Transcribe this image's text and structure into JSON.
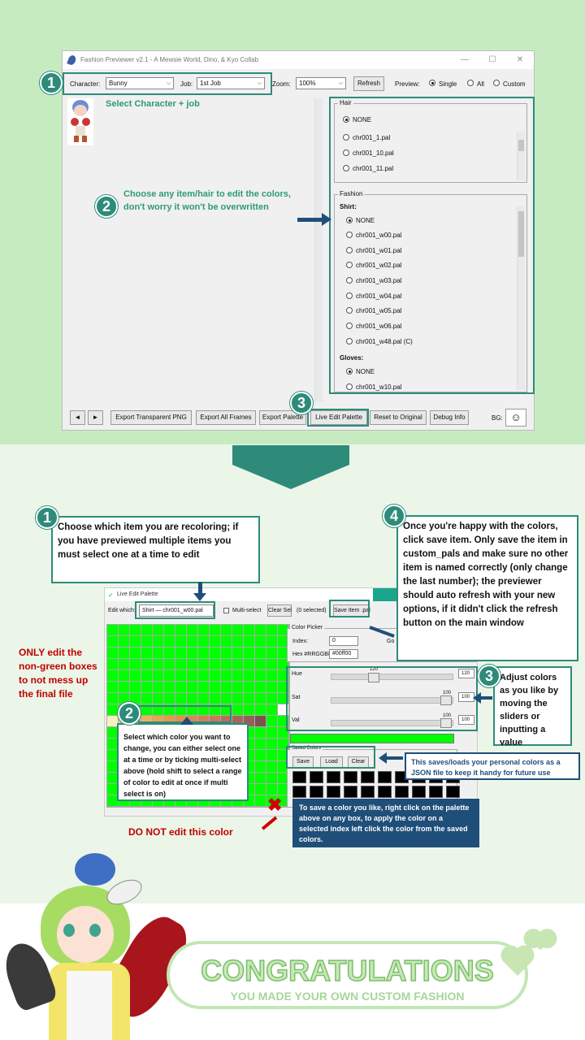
{
  "app": {
    "title": "Fashion Previewer v2.1 - A Mewsie World, Dino, & Kyo Collab",
    "minimize": "—",
    "maximize": "☐",
    "close": "✕"
  },
  "toolbar": {
    "character_label": "Character:",
    "character_value": "Bunny",
    "job_label": "Job:",
    "job_value": "1st Job",
    "zoom_label": "Zoom:",
    "zoom_value": "100%",
    "refresh": "Refresh",
    "preview_label": "Preview:",
    "preview_options": [
      "Single",
      "All",
      "Custom"
    ]
  },
  "hair": {
    "title": "Hair",
    "items": [
      "NONE",
      "chr001_1.pal",
      "chr001_10.pal",
      "chr001_11.pal"
    ]
  },
  "fashion": {
    "title": "Fashion",
    "shirt_label": "Shirt:",
    "shirt_items": [
      "NONE",
      "chr001_w00.pal",
      "chr001_w01.pal",
      "chr001_w02.pal",
      "chr001_w03.pal",
      "chr001_w04.pal",
      "chr001_w05.pal",
      "chr001_w06.pal",
      "chr001_w48.pal (C)"
    ],
    "gloves_label": "Gloves:",
    "gloves_items": [
      "NONE",
      "chr001_w10.pal"
    ]
  },
  "bottom_bar": {
    "prev": "◄",
    "next": "►",
    "export_png": "Export Transparent PNG",
    "export_frames": "Export All Frames",
    "export_palette": "Export Palette",
    "live_edit": "Live Edit Palette",
    "reset": "Reset to Original",
    "debug": "Debug Info",
    "bg_label": "BG:"
  },
  "callouts_top": {
    "n1": "1",
    "n2": "2",
    "n3": "3",
    "select_char": "Select Character + job",
    "choose_item": "Choose any item/hair to edit the colors, don't worry it won't be overwritten"
  },
  "live_edit": {
    "title": "Live Edit Palette",
    "edit_which_label": "Edit which:",
    "edit_which_value": "Shirt — chr001_w00.pal",
    "multi_select": "Multi-select",
    "clear_sel": "Clear Sel",
    "selected": "(0 selected)",
    "save_item": "Save Item .pal",
    "color_picker": "Color Picker",
    "index_label": "Index:",
    "index_value": "0",
    "go": "Go",
    "hex_label": "Hex #RRGGBB:",
    "hex_value": "#00ff00",
    "hue_label": "Hue",
    "hue_value": "120",
    "sat_label": "Sat",
    "sat_value": "100",
    "val_label": "Val",
    "val_value": "100",
    "saved_colors": "Saved Colors",
    "save": "Save",
    "load": "Load",
    "clear": "Clear"
  },
  "palette_colors": [
    "#f6d27e",
    "#f3c070",
    "#eeb060",
    "#e8a453",
    "#e39a4c",
    "#dd9050",
    "#d88758",
    "#d07e5a",
    "#c9785a",
    "#b86f58",
    "#a6665a",
    "#965e5a",
    "#7d524e"
  ],
  "callouts_bottom": {
    "n1": "1",
    "n2": "2",
    "n3": "3",
    "n4": "4",
    "choose_which": "Choose which item you are recoloring; if you have previewed multiple items you must select one at a time to edit",
    "save_note": "Once you're happy with the colors, click save item. Only save the item in custom_pals and make sure no other item is named correctly (only change the last number); the previewer should auto refresh with your new options, if it didn't click the refresh button on the main window",
    "only_edit": "ONLY edit the non-green boxes to not mess up the final file",
    "select_color": "Select which color you want to change, you can either select one at a time or by ticking multi-select above (hold shift to select a range of color to edit at once if multi select is on)",
    "adjust": "Adjust colors as you like by moving the sliders or inputting a value",
    "saves_loads": "This saves/loads your personal colors as a JSON file to keep it handy for future use",
    "right_click": "To save a color you like, right click on the palette above on any box, to apply the color on a selected index left click the color from the saved colors.",
    "do_not": "DO NOT edit this color"
  },
  "footer": {
    "congrats": "CONGRATULATIONS",
    "subtitle": "YOU MADE YOUR OWN CUSTOM FASHION"
  },
  "colors": {
    "teal": "#2e8b7a",
    "navy": "#1f4e79",
    "green_cell": "#00ff00",
    "red": "#c00000"
  }
}
